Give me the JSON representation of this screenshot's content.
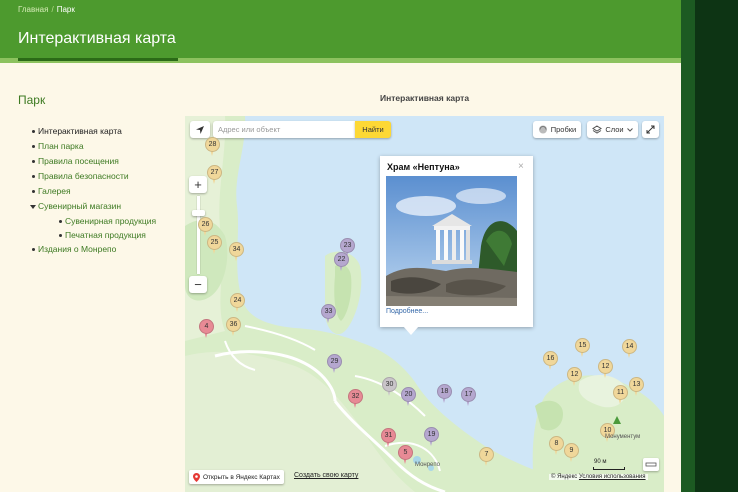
{
  "breadcrumbs": {
    "home": "Главная",
    "separator": "/",
    "current": "Парк"
  },
  "page_title": "Интерактивная карта",
  "sidebar": {
    "title": "Парк",
    "items": [
      {
        "label": "Интерактивная карта"
      },
      {
        "label": "План парка"
      },
      {
        "label": "Правила посещения"
      },
      {
        "label": "Правила безопасности"
      },
      {
        "label": "Галерея"
      },
      {
        "label": "Сувенирный магазин"
      },
      {
        "label": "Издания о Монрепо"
      }
    ],
    "subitems": [
      {
        "label": "Сувенирная продукция"
      },
      {
        "label": "Печатная продукция"
      }
    ]
  },
  "content_title": "Интерактивная карта",
  "map": {
    "search_placeholder": "Адрес или объект",
    "search_button": "Найти",
    "traffic": "Пробки",
    "layers": "Слои",
    "zoom_in": "+",
    "zoom_out": "−",
    "popup": {
      "title": "Храм «Нептуна»",
      "close": "×",
      "more": "Подробнее..."
    },
    "open_yandex": "Открыть в Яндекс Картах",
    "create_map": "Создать свою карту",
    "copyright": "© Яндекс",
    "terms": "Условия использования",
    "scale": "90 м",
    "poi_label": "Монументум",
    "poi_label2": "Монрепо",
    "colors": {
      "purple": "#b5a7cf",
      "yellow": "#f0d79a",
      "red": "#e78a95",
      "gray": "#c9c4c9"
    },
    "markers": [
      {
        "n": "28",
        "c": "yellow"
      },
      {
        "n": "27",
        "c": "yellow"
      },
      {
        "n": "26",
        "c": "yellow"
      },
      {
        "n": "25",
        "c": "yellow"
      },
      {
        "n": "34",
        "c": "yellow"
      },
      {
        "n": "23",
        "c": "purple"
      },
      {
        "n": "22",
        "c": "purple"
      },
      {
        "n": "24",
        "c": "yellow"
      },
      {
        "n": "36",
        "c": "yellow"
      },
      {
        "n": "4",
        "c": "red"
      },
      {
        "n": "33",
        "c": "purple"
      },
      {
        "n": "29",
        "c": "purple"
      },
      {
        "n": "30",
        "c": "gray"
      },
      {
        "n": "20",
        "c": "purple"
      },
      {
        "n": "18",
        "c": "purple"
      },
      {
        "n": "17",
        "c": "purple"
      },
      {
        "n": "32",
        "c": "red"
      },
      {
        "n": "19",
        "c": "purple"
      },
      {
        "n": "31",
        "c": "red"
      },
      {
        "n": "5",
        "c": "red"
      },
      {
        "n": "7",
        "c": "yellow"
      },
      {
        "n": "16",
        "c": "yellow"
      },
      {
        "n": "15",
        "c": "yellow"
      },
      {
        "n": "14",
        "c": "yellow"
      },
      {
        "n": "12",
        "c": "yellow"
      },
      {
        "n": "12",
        "c": "yellow"
      },
      {
        "n": "13",
        "c": "yellow"
      },
      {
        "n": "11",
        "c": "yellow"
      },
      {
        "n": "10",
        "c": "yellow"
      },
      {
        "n": "8",
        "c": "yellow"
      },
      {
        "n": "9",
        "c": "yellow"
      }
    ]
  }
}
